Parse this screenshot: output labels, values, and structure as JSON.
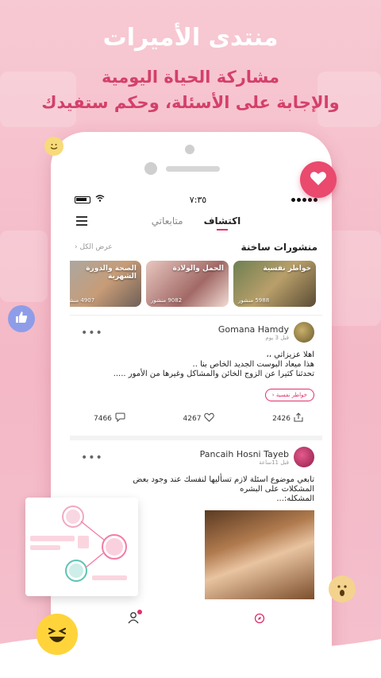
{
  "banner": {
    "title": "منتدى الأميرات",
    "line1": "مشاركة الحياة اليومية",
    "line2": "والإجابة على الأسئلة، وحكم ستفيدك"
  },
  "status_bar": {
    "time": "٧:٣٥"
  },
  "tabs": [
    {
      "label": "اكتشاف",
      "active": true
    },
    {
      "label": "متابعاتي",
      "active": false
    }
  ],
  "hot_section": {
    "title": "منشورات ساخنة",
    "see_all": "عرض الكل",
    "cards": [
      {
        "title": "خواطر نفسية",
        "count": "5988 منشور"
      },
      {
        "title": "الحمل والولادة",
        "count": "9082 منشور"
      },
      {
        "title": "الصحة والدورة الشهرية",
        "count": "4907 منشور"
      }
    ]
  },
  "posts": [
    {
      "author": "Gomana Hamdy",
      "time": "قبل 3 يوم",
      "lines": [
        "اهلا عزيزاتي ،،",
        "هذا ميعاد البوست الجديد الخاص بنا ..",
        "تحدثنا كثيرا عن الزوج الخائن والمشاكل وغيرها من الأمور ....."
      ],
      "tag": "خواطر نفسية",
      "comments": "7466",
      "likes": "4267",
      "shares": "2426"
    },
    {
      "author": "Pancaih Hosni Tayeb",
      "time": "قبل 11ساعة",
      "lines": [
        "تابعي موضوع اسئلة لازم تسأليها لنفسك عند وجود بعض",
        "المشكلات على البشره",
        "المشكله:..."
      ]
    }
  ],
  "colors": {
    "accent": "#e0306a",
    "banner_text": "#d4406a",
    "background": "#f5c0cd"
  }
}
